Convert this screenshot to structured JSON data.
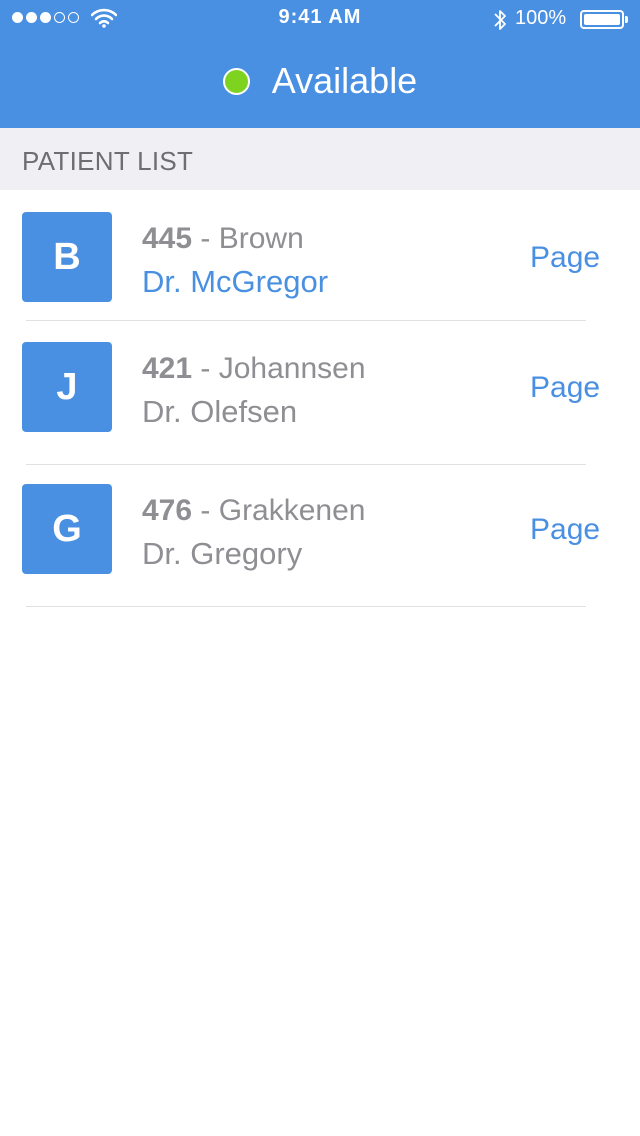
{
  "status_bar": {
    "time": "9:41 AM",
    "battery": "100%",
    "signal_bars_filled": 3,
    "signal_bars_total": 5
  },
  "header": {
    "status_label": "Available",
    "status_color": "#7ed321",
    "background_color": "#4a90e2"
  },
  "section": {
    "title": "PATIENT LIST"
  },
  "patients": [
    {
      "initial": "B",
      "room": "445",
      "separator": " - ",
      "name": "Brown",
      "doctor": "Dr. McGregor",
      "doctor_highlighted": true,
      "action": "Page"
    },
    {
      "initial": "J",
      "room": "421",
      "separator": " - ",
      "name": "Johannsen",
      "doctor": "Dr. Olefsen",
      "doctor_highlighted": false,
      "action": "Page"
    },
    {
      "initial": "G",
      "room": "476",
      "separator": " - ",
      "name": "Grakkenen",
      "doctor": "Dr. Gregory",
      "doctor_highlighted": false,
      "action": "Page"
    }
  ],
  "colors": {
    "accent": "#4a90e2",
    "muted_text": "#8e8e93",
    "section_bg": "#efeff4"
  }
}
